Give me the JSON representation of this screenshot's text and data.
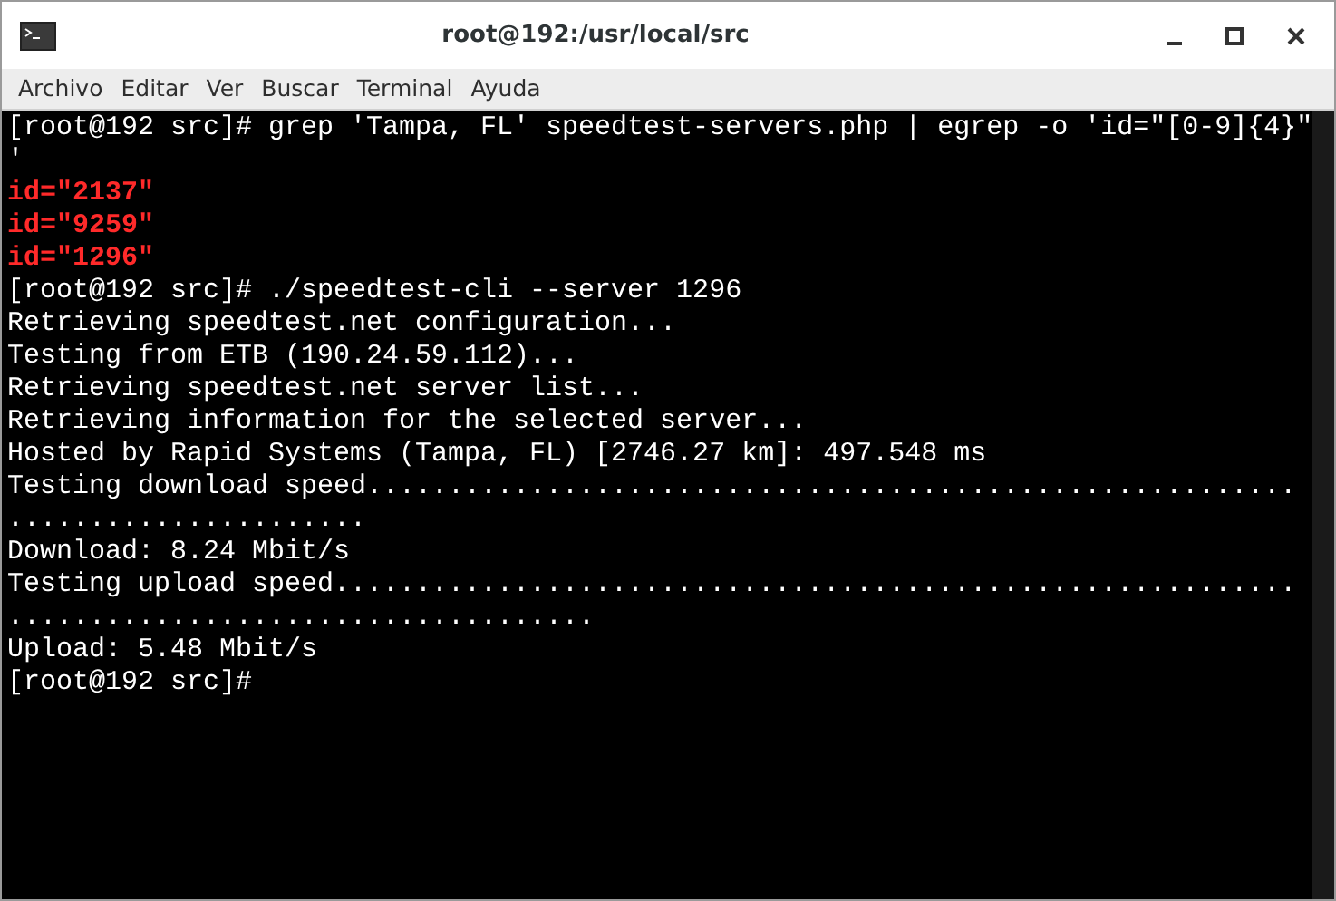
{
  "window": {
    "title": "root@192:/usr/local/src"
  },
  "menu": [
    "Archivo",
    "Editar",
    "Ver",
    "Buscar",
    "Terminal",
    "Ayuda"
  ],
  "terminal": {
    "lines": [
      {
        "kind": "output",
        "text": "[root@192 src]# grep 'Tampa, FL' speedtest-servers.php | egrep -o 'id=\"[0-9]{4}\""
      },
      {
        "kind": "output",
        "text": "'"
      },
      {
        "kind": "match",
        "text": "id=\"2137\""
      },
      {
        "kind": "match",
        "text": "id=\"9259\""
      },
      {
        "kind": "match",
        "text": "id=\"1296\""
      },
      {
        "kind": "output",
        "text": "[root@192 src]# ./speedtest-cli --server 1296"
      },
      {
        "kind": "output",
        "text": "Retrieving speedtest.net configuration..."
      },
      {
        "kind": "output",
        "text": "Testing from ETB (190.24.59.112)..."
      },
      {
        "kind": "output",
        "text": "Retrieving speedtest.net server list..."
      },
      {
        "kind": "output",
        "text": "Retrieving information for the selected server..."
      },
      {
        "kind": "output",
        "text": "Hosted by Rapid Systems (Tampa, FL) [2746.27 km]: 497.548 ms"
      },
      {
        "kind": "output",
        "text": "Testing download speed........................................................."
      },
      {
        "kind": "output",
        "text": "......................"
      },
      {
        "kind": "output",
        "text": "Download: 8.24 Mbit/s"
      },
      {
        "kind": "output",
        "text": "Testing upload speed..........................................................."
      },
      {
        "kind": "output",
        "text": "...................................."
      },
      {
        "kind": "output",
        "text": "Upload: 5.48 Mbit/s"
      },
      {
        "kind": "output",
        "text": "[root@192 src]#"
      }
    ]
  }
}
